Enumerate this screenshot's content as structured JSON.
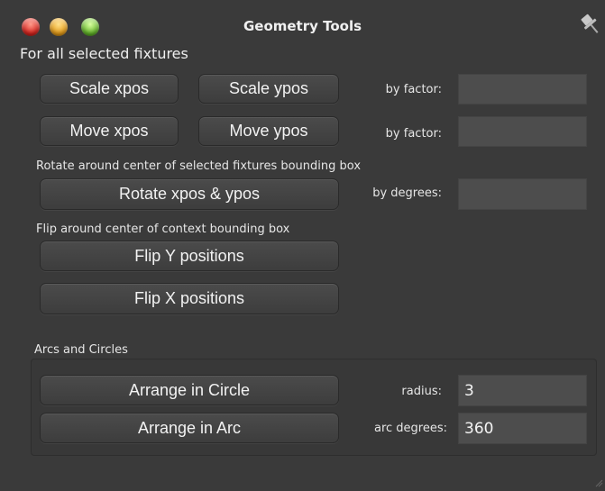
{
  "window": {
    "title": "Geometry Tools",
    "controls": [
      "close",
      "minimize",
      "zoom"
    ],
    "pin_icon": "pin-icon"
  },
  "section_main": {
    "heading": "For all selected fixtures",
    "scale": {
      "x_label": "Scale xpos",
      "y_label": "Scale ypos",
      "field_label": "by factor:",
      "value": ""
    },
    "move": {
      "x_label": "Move xpos",
      "y_label": "Move ypos",
      "field_label": "by factor:",
      "value": ""
    },
    "rotate_heading": "Rotate around center of selected fixtures bounding box",
    "rotate": {
      "label": "Rotate xpos & ypos",
      "field_label": "by degrees:",
      "value": ""
    },
    "flip_heading": "Flip around center of context bounding box",
    "flip_y_label": "Flip Y positions",
    "flip_x_label": "Flip X positions"
  },
  "section_arcs": {
    "heading": "Arcs and Circles",
    "circle": {
      "label": "Arrange in Circle",
      "field_label": "radius:",
      "value": "3"
    },
    "arc": {
      "label": "Arrange in Arc",
      "field_label": "arc degrees:",
      "value": "360"
    }
  },
  "colors": {
    "background": "#3a3a3a",
    "button": "#454545",
    "field": "#4d4d4d",
    "text": "#e8e8e8"
  }
}
